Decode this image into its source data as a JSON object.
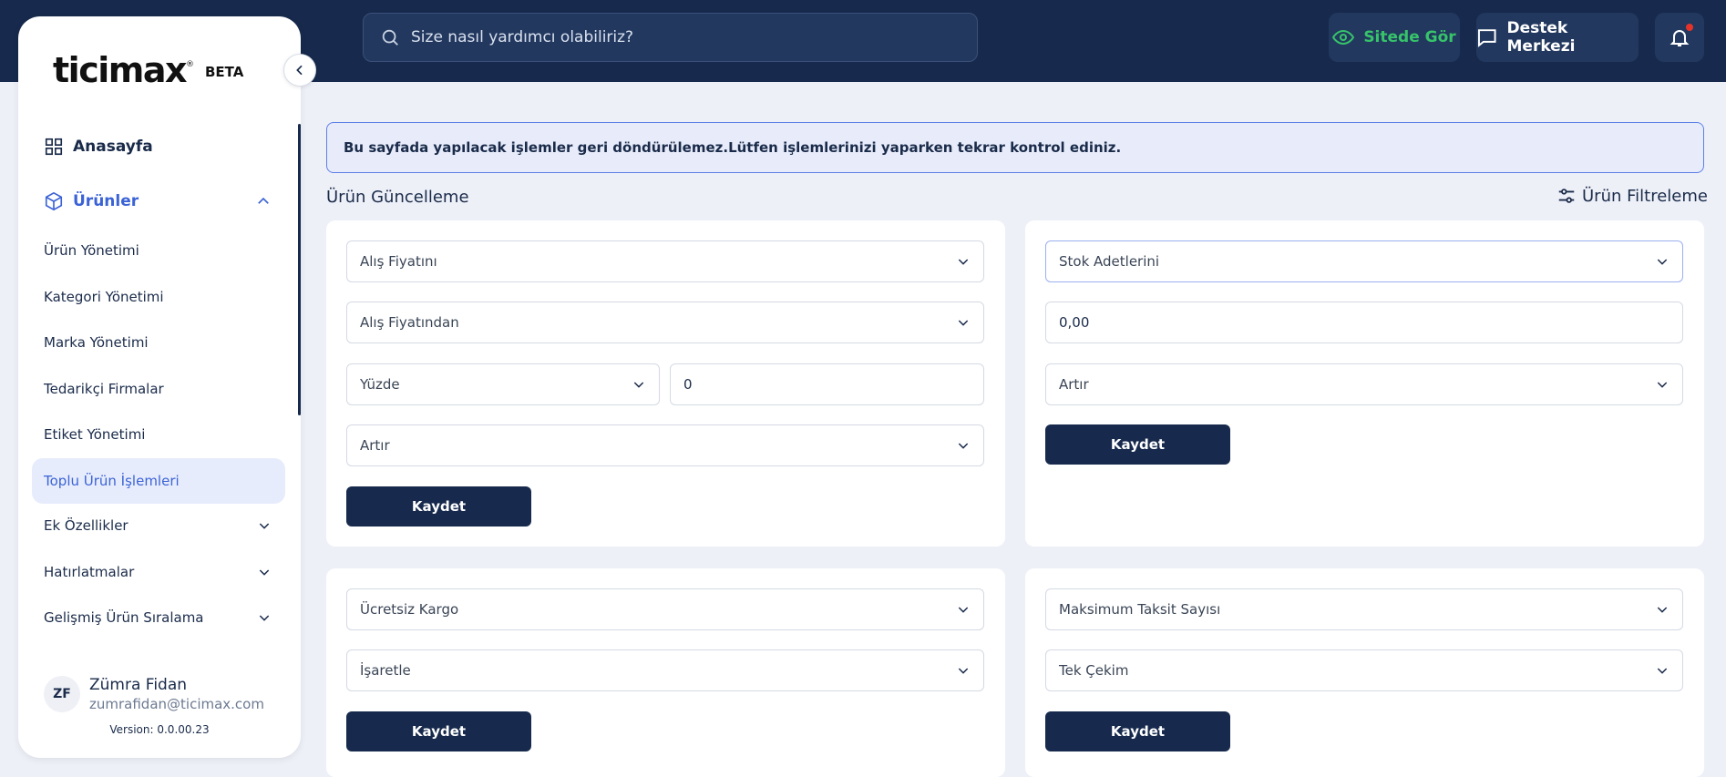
{
  "topbar": {
    "search_placeholder": "Size nasıl yardımcı olabiliriz?",
    "site_button": "Sitede Gör",
    "support_button": "Destek Merkezi"
  },
  "sidebar": {
    "logo": "ticimax",
    "beta": "BETA",
    "home": "Anasayfa",
    "products": "Ürünler",
    "sub_items": [
      "Ürün Yönetimi",
      "Kategori Yönetimi",
      "Marka Yönetimi",
      "Tedarikçi Firmalar",
      "Etiket Yönetimi",
      "Toplu Ürün İşlemleri"
    ],
    "expandable": [
      "Ek Özellikler",
      "Hatırlatmalar",
      "Gelişmiş Ürün Sıralama"
    ],
    "user": {
      "initials": "ZF",
      "name": "Zümra Fidan",
      "email": "zumrafidan@ticimax.com"
    },
    "version": "Version: 0.0.00.23"
  },
  "main": {
    "alert": "Bu sayfada yapılacak işlemler geri döndürülemez.Lütfen işlemlerinizi yaparken tekrar kontrol ediniz.",
    "title": "Ürün Güncelleme",
    "filter_button": "Ürün Filtreleme",
    "save_label": "Kaydet",
    "card1": {
      "field": "Alış Fiyatını",
      "source": "Alış Fiyatından",
      "mode": "Yüzde",
      "amount": "0",
      "action": "Artır"
    },
    "card2": {
      "field": "Stok Adetlerini",
      "amount": "0,00",
      "action": "Artır"
    },
    "card3": {
      "field": "Ücretsiz Kargo",
      "action": "İşaretle"
    },
    "card4": {
      "field": "Maksimum Taksit Sayısı",
      "value": "Tek Çekim"
    }
  },
  "colors": {
    "navy": "#172a4d",
    "accent": "#3b63d6",
    "green": "#37c36a",
    "alert_bg": "#e8ecfa"
  }
}
